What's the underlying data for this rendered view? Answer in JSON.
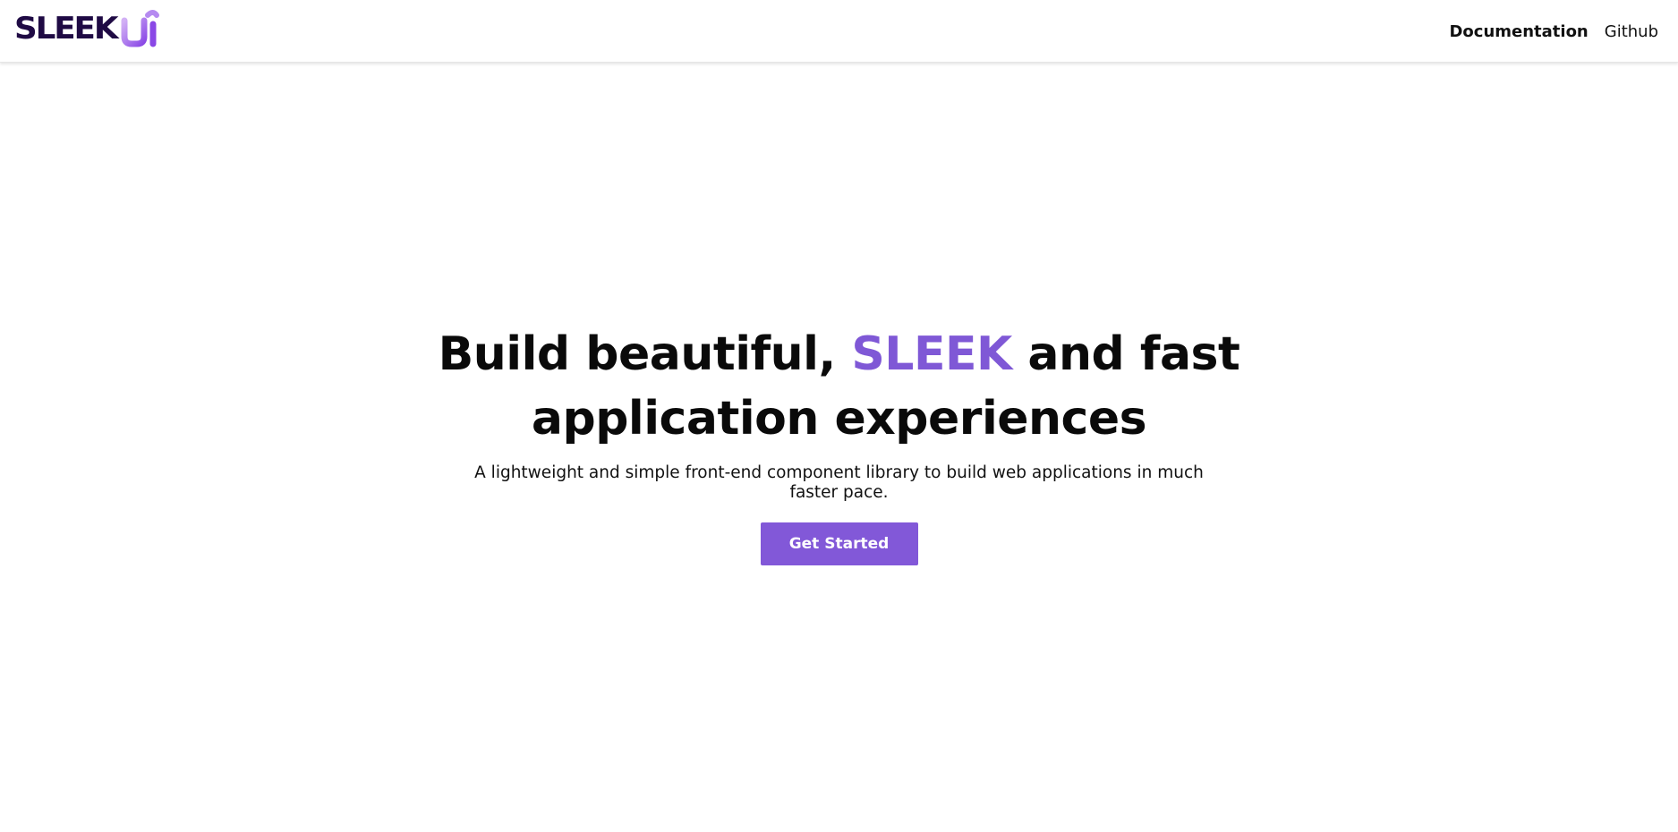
{
  "header": {
    "logo_text": "SLEEK",
    "logo_mark": "Ui",
    "nav": [
      {
        "label": "Documentation",
        "active": true
      },
      {
        "label": "Github",
        "active": false
      }
    ]
  },
  "hero": {
    "title_part1": "Build beautiful, ",
    "title_accent": "SLEEK",
    "title_part2": " and fast",
    "title_line2": "application experiences",
    "subtitle": "A lightweight and simple front-end component library to build web applications in much faster pace.",
    "cta_label": "Get Started"
  },
  "colors": {
    "brand_dark": "#1f0a44",
    "accent": "#7f58d6",
    "logo_gradient_start": "#c6a1f2",
    "logo_gradient_end": "#8a48e6"
  },
  "icons": {
    "logo_mark_icon": "ui-logo-icon"
  }
}
